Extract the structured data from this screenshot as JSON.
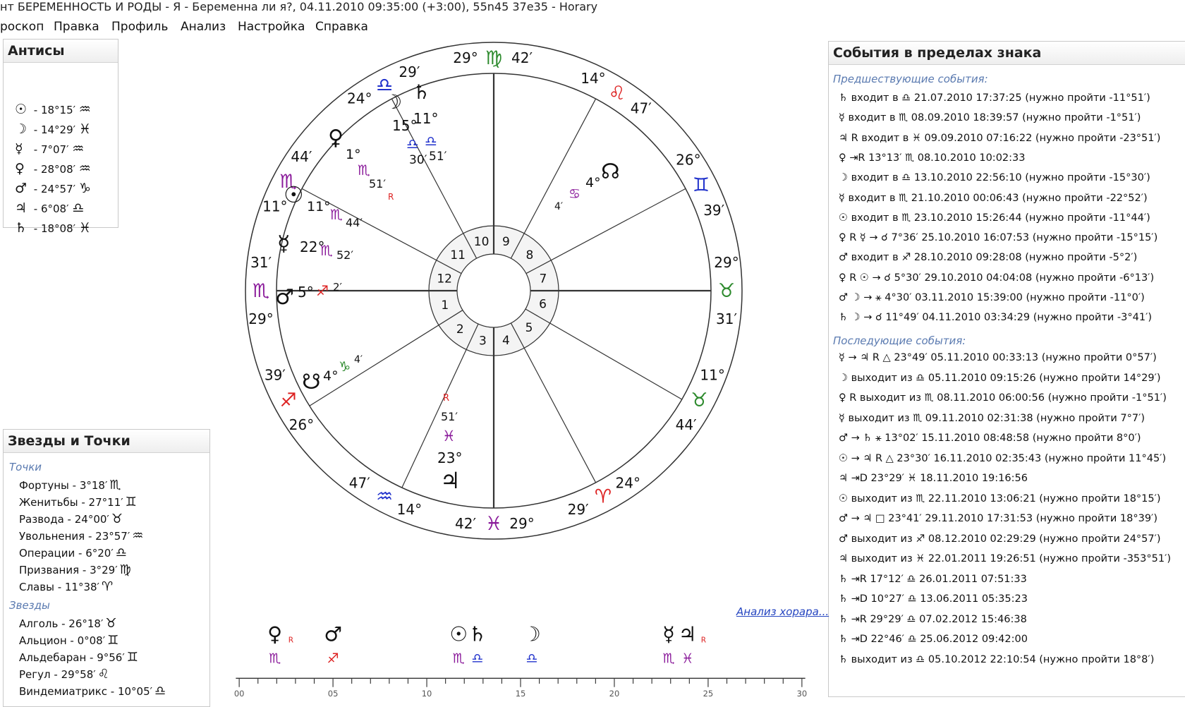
{
  "window": {
    "title": "нт БЕРЕМЕННОСТЬ И РОДЫ - Я - Беременна ли я?, 04.11.2010 09:35:00 (+3:00), 55n45 37e35 - Horary"
  },
  "menu": [
    "роскоп",
    "Правка",
    "Профиль",
    "Анализ",
    "Настройка",
    "Справка"
  ],
  "antis": {
    "title": "Антисы",
    "rows": [
      {
        "planet": "☉",
        "text": " - 18°15′ ",
        "sign": "♒"
      },
      {
        "planet": "☽",
        "text": " - 14°29′ ",
        "sign": "♓"
      },
      {
        "planet": "☿",
        "text": " - 7°07′ ",
        "sign": "♒"
      },
      {
        "planet": "♀",
        "text": " - 28°08′ ",
        "sign": "♒"
      },
      {
        "planet": "♂",
        "text": " - 24°57′ ",
        "sign": "♑"
      },
      {
        "planet": "♃",
        "text": " - 6°08′ ",
        "sign": "♎"
      },
      {
        "planet": "♄",
        "text": " - 18°08′ ",
        "sign": "♓"
      }
    ]
  },
  "stars": {
    "title": "Звезды и Точки",
    "points_label": "Точки",
    "points": [
      {
        "text": "Фортуны - 3°18′",
        "sign": "♏"
      },
      {
        "text": "Женитьбы - 27°11′",
        "sign": "♊"
      },
      {
        "text": "Развода - 24°00′",
        "sign": "♉"
      },
      {
        "text": "Увольнения - 23°57′",
        "sign": "♒"
      },
      {
        "text": "Операции - 6°20′",
        "sign": "♎"
      },
      {
        "text": "Призвания - 3°29′",
        "sign": "♍"
      },
      {
        "text": "Славы - 11°38′",
        "sign": "♈"
      }
    ],
    "stars_label": "Звезды",
    "stars": [
      {
        "text": "Алголь - 26°18′",
        "sign": "♉"
      },
      {
        "text": "Альцион - 0°08′",
        "sign": "♊"
      },
      {
        "text": "Альдебаран - 9°56′",
        "sign": "♊"
      },
      {
        "text": "Регул - 29°58′",
        "sign": "♌"
      },
      {
        "text": "Виндемиатрикс - 10°05′",
        "sign": "♎"
      }
    ]
  },
  "events": {
    "title": "События в пределах знака",
    "prev_label": "Предшествующие события:",
    "next_label": "Последующие события:",
    "prev": [
      "♄ входит в ♎ 21.07.2010 17:37:25 (нужно пройти -11°51′)",
      "☿ входит в ♏ 08.09.2010 18:39:57 (нужно пройти -1°51′)",
      "♃ R входит в ♓ 09.09.2010 07:16:22 (нужно пройти -23°51′)",
      "♀ ⇥R 13°13′ ♏ 08.10.2010 10:02:33",
      "☽ входит в ♎ 13.10.2010 22:56:10 (нужно пройти -15°30′)",
      "☿ входит в ♏ 21.10.2010 00:06:43 (нужно пройти -22°52′)",
      "☉ входит в ♏ 23.10.2010 15:26:44 (нужно пройти -11°44′)",
      "♀ R ☿ → ☌ 7°36′ 25.10.2010 16:07:53 (нужно пройти -15°15′)",
      "♂ входит в ♐ 28.10.2010 09:28:08 (нужно пройти -5°2′)",
      "♀ R ☉ → ☌ 5°30′ 29.10.2010 04:04:08 (нужно пройти -6°13′)",
      "♂ ☽ → ⚹ 4°30′ 03.11.2010 15:39:00 (нужно пройти -11°0′)",
      "♄ ☽ → ☌ 11°49′ 04.11.2010 03:34:29 (нужно пройти -3°41′)"
    ],
    "next": [
      "☿ → ♃ R △ 23°49′ 05.11.2010 00:33:13 (нужно пройти 0°57′)",
      "☽ выходит из ♎ 05.11.2010 09:15:26 (нужно пройти 14°29′)",
      "♀ R выходит из ♏ 08.11.2010 06:00:56 (нужно пройти -1°51′)",
      "☿ выходит из ♏ 09.11.2010 02:31:38 (нужно пройти 7°7′)",
      "♂ → ♄ ⚹ 13°02′ 15.11.2010 08:48:58 (нужно пройти 8°0′)",
      "☉ → ♃ R △ 23°30′ 16.11.2010 02:35:43 (нужно пройти 11°45′)",
      "♃ ⇥D 23°29′ ♓ 18.11.2010 19:16:56",
      "☉ выходит из ♏ 22.11.2010 13:06:21 (нужно пройти 18°15′)",
      "♂ → ♃ □ 23°41′ 29.11.2010 17:31:53 (нужно пройти 18°39′)",
      "♂ выходит из ♐ 08.12.2010 02:29:29 (нужно пройти 24°57′)",
      "♃ выходит из ♓ 22.01.2011 19:26:51 (нужно пройти -353°51′)",
      "♄ ⇥R 17°12′ ♎ 26.01.2011 07:51:33",
      "♄ ⇥D 10°27′ ♎ 13.06.2011 05:35:23",
      "♄ ⇥R 29°29′ ♎ 07.02.2012 15:46:38",
      "♄ ⇥D 22°46′ ♎ 25.06.2012 09:42:00",
      "♄ выходит из ♎ 05.10.2012 22:10:54 (нужно пройти 18°8′)"
    ]
  },
  "analysis_link": "Анализ хорара...",
  "chart": {
    "houses": [
      "1",
      "2",
      "3",
      "4",
      "5",
      "6",
      "7",
      "8",
      "9",
      "10",
      "11",
      "12"
    ],
    "cusps": [
      {
        "deg": "29°",
        "sign": "♍",
        "min": "42′",
        "color": "#2d8a2d"
      },
      {
        "deg": "14°",
        "sign": "♌",
        "min": "47′",
        "color": "#d22"
      },
      {
        "deg": "26°",
        "sign": "♊",
        "min": "39′",
        "color": "#2233cc"
      },
      {
        "deg": "29°",
        "sign": "♉",
        "min": "31′",
        "color": "#2d8a2d"
      },
      {
        "deg": "11°",
        "sign": "♉",
        "min": "44′",
        "color": "#2d8a2d"
      },
      {
        "deg": "24°",
        "sign": "♈",
        "min": "29′",
        "color": "#d22"
      },
      {
        "deg": "29°",
        "sign": "♓",
        "min": "42′",
        "color": "#8a1a9a"
      },
      {
        "deg": "14°",
        "sign": "♒",
        "min": "47′",
        "color": "#2233cc"
      },
      {
        "deg": "26°",
        "sign": "♐",
        "min": "39′",
        "color": "#d22"
      },
      {
        "deg": "29°",
        "sign": "♏",
        "min": "31′",
        "color": "#8a1a9a"
      },
      {
        "deg": "11°",
        "sign": "♏",
        "min": "44′",
        "color": "#8a1a9a"
      },
      {
        "deg": "24°",
        "sign": "♎",
        "min": "29′",
        "color": "#2233cc"
      }
    ],
    "planets": {
      "moon_saturn": {
        "g1": "☽",
        "g2": "♄",
        "deg": "15°",
        "deg2": "11°",
        "sign": "♎",
        "sign2": "♎",
        "min": "30′",
        "min2": "51′"
      },
      "venus": {
        "g": "♀",
        "deg": "1°",
        "sign": "♏",
        "min": "51′",
        "retro": "R"
      },
      "sun": {
        "g": "☉",
        "deg": "11°",
        "sign": "♏",
        "min": "44′"
      },
      "mercury": {
        "g": "☿",
        "deg": "22°",
        "sign": "♏",
        "min": "52′"
      },
      "mars": {
        "g": "♂",
        "deg": "5°",
        "sign": "♐",
        "min": "2′"
      },
      "node_north": {
        "g": "☊",
        "deg": "4°",
        "sign": "♋",
        "min": "4′"
      },
      "node_south": {
        "g": "☋",
        "deg": "4°",
        "sign": "♑",
        "min": "4′"
      },
      "jupiter": {
        "g": "♃",
        "deg": "23°",
        "sign": "♓",
        "min": "51′",
        "retro": "R"
      }
    }
  },
  "strip": {
    "items": [
      {
        "g": "♀",
        "r": "R",
        "sign": "♏",
        "deg": 1.9
      },
      {
        "g": "♂",
        "r": "",
        "sign": "♐",
        "deg": 5.0
      },
      {
        "g": "☉",
        "r": "",
        "sign": "♏",
        "deg": 11.7
      },
      {
        "g": "♄",
        "r": "",
        "sign": "♎",
        "deg": 12.7
      },
      {
        "g": "☽",
        "r": "",
        "sign": "♎",
        "deg": 15.6
      },
      {
        "g": "☿",
        "r": "",
        "sign": "♏",
        "deg": 22.9
      },
      {
        "g": "♃",
        "r": "R",
        "sign": "♓",
        "deg": 23.9
      }
    ],
    "ticks": [
      "00",
      "05",
      "10",
      "15",
      "20",
      "25",
      "30"
    ]
  }
}
